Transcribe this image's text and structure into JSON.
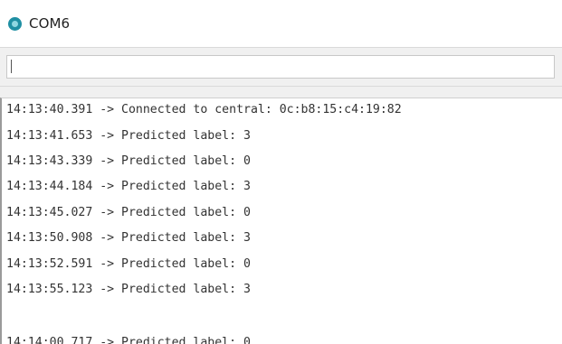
{
  "window": {
    "title": "COM6",
    "icon": "serial-monitor-app-icon",
    "accent_color": "#1f8fa3"
  },
  "send_field": {
    "value": "",
    "placeholder": ""
  },
  "output": {
    "lines": [
      "14:13:40.391 -> Connected to central: 0c:b8:15:c4:19:82",
      "14:13:41.653 -> Predicted label: 3",
      "14:13:43.339 -> Predicted label: 0",
      "14:13:44.184 -> Predicted label: 3",
      "14:13:45.027 -> Predicted label: 0",
      "14:13:50.908 -> Predicted label: 3",
      "14:13:52.591 -> Predicted label: 0",
      "14:13:55.123 -> Predicted label: 3",
      "14:14:00.717 -> Predicted label: 0"
    ]
  }
}
